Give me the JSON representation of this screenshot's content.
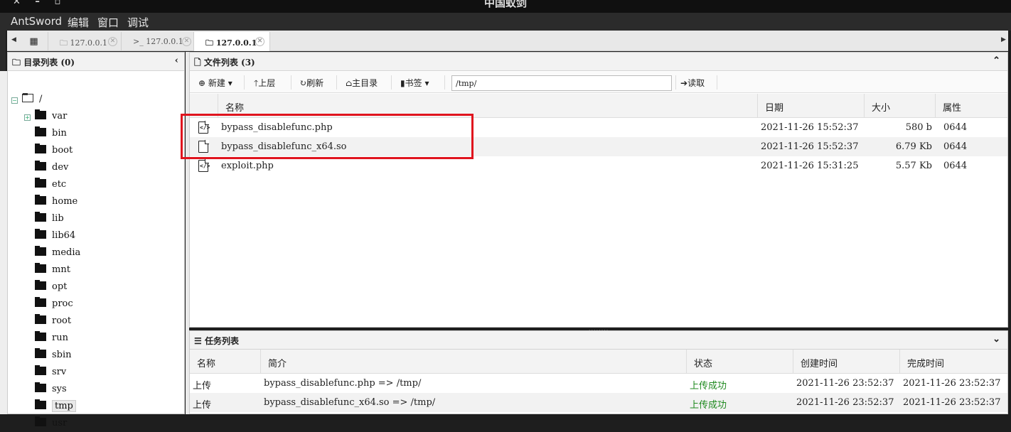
{
  "window": {
    "title": "中国蚁剑",
    "controls": "✕ – ▫"
  },
  "menu": [
    "AntSword",
    "编辑",
    "窗口",
    "调试"
  ],
  "tabs": [
    {
      "label": "127.0.0.1",
      "icon": "folder-icon",
      "active": false
    },
    {
      "label": "127.0.0.1",
      "icon": "terminal-icon",
      "prefix": ">_",
      "active": false
    },
    {
      "label": "127.0.0.1",
      "icon": "folder-icon",
      "active": true
    }
  ],
  "dirpanel": {
    "title": "目录列表 (0)",
    "root": "/",
    "folders": [
      "var",
      "bin",
      "boot",
      "dev",
      "etc",
      "home",
      "lib",
      "lib64",
      "media",
      "mnt",
      "opt",
      "proc",
      "root",
      "run",
      "sbin",
      "srv",
      "sys",
      "tmp",
      "usr"
    ],
    "selected": "tmp"
  },
  "filepanel": {
    "title": "文件列表 (3)",
    "toolbar": {
      "new": "新建",
      "up": "上层",
      "refresh": "刷新",
      "home": "主目录",
      "bookmark": "书签",
      "path": "/tmp/",
      "read": "读取"
    },
    "columns": [
      "名称",
      "日期",
      "大小",
      "属性"
    ],
    "files": [
      {
        "name": "bypass_disablefunc.php",
        "date": "2021-11-26 15:52:37",
        "size": "580 b",
        "perm": "0644",
        "icon": "php-file-icon"
      },
      {
        "name": "bypass_disablefunc_x64.so",
        "date": "2021-11-26 15:52:37",
        "size": "6.79 Kb",
        "perm": "0644",
        "icon": "file-icon"
      },
      {
        "name": "exploit.php",
        "date": "2021-11-26 15:31:25",
        "size": "5.57 Kb",
        "perm": "0644",
        "icon": "php-file-icon"
      }
    ]
  },
  "taskpanel": {
    "title": "任务列表",
    "columns": [
      "名称",
      "简介",
      "状态",
      "创建时间",
      "完成时间"
    ],
    "tasks": [
      {
        "name": "上传",
        "desc": "bypass_disablefunc.php => /tmp/",
        "status": "上传成功",
        "created": "2021-11-26 23:52:37",
        "done": "2021-11-26 23:52:37"
      },
      {
        "name": "上传",
        "desc": "bypass_disablefunc_x64.so => /tmp/",
        "status": "上传成功",
        "created": "2021-11-26 23:52:37",
        "done": "2021-11-26 23:52:37"
      }
    ]
  },
  "colors": {
    "highlight": "#e0141e",
    "success": "#1f8a1f",
    "menubar": "#2b2b2b"
  }
}
